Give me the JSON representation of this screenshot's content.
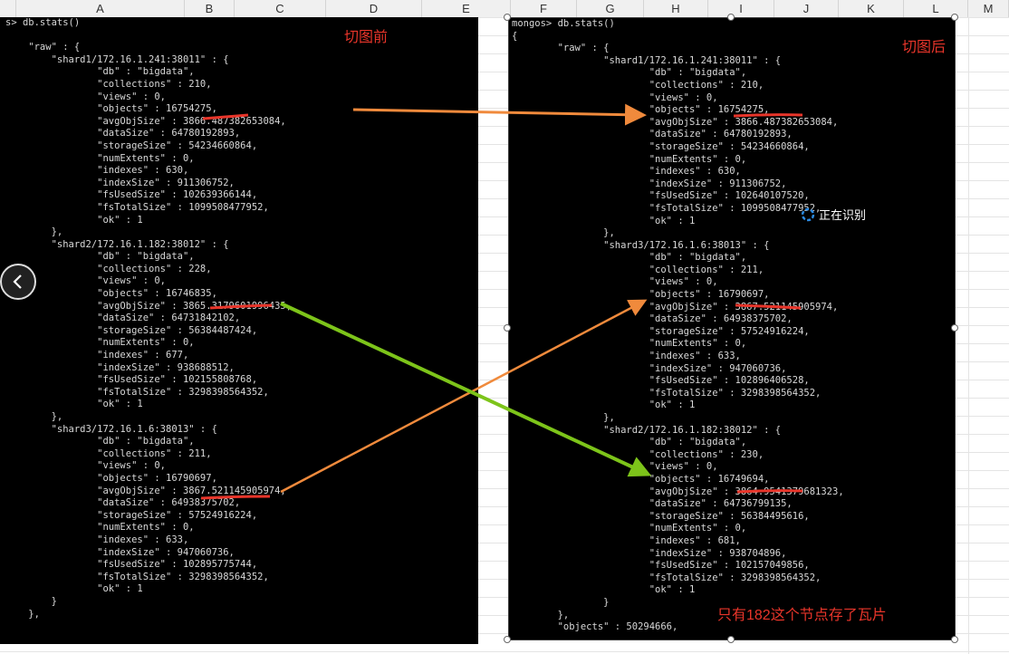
{
  "columns": [
    "A",
    "B",
    "C",
    "D",
    "E",
    "F",
    "G",
    "H",
    "I",
    "J",
    "K",
    "L",
    "M"
  ],
  "left_terminal": {
    "lines": [
      "s> db.stats()",
      "",
      "    \"raw\" : {",
      "        \"shard1/172.16.1.241:38011\" : {",
      "                \"db\" : \"bigdata\",",
      "                \"collections\" : 210,",
      "                \"views\" : 0,",
      "                \"objects\" : 16754275,",
      "                \"avgObjSize\" : 3866.487382653084,",
      "                \"dataSize\" : 64780192893,",
      "                \"storageSize\" : 54234660864,",
      "                \"numExtents\" : 0,",
      "                \"indexes\" : 630,",
      "                \"indexSize\" : 911306752,",
      "                \"fsUsedSize\" : 102639366144,",
      "                \"fsTotalSize\" : 1099508477952,",
      "                \"ok\" : 1",
      "        },",
      "        \"shard2/172.16.1.182:38012\" : {",
      "                \"db\" : \"bigdata\",",
      "                \"collections\" : 228,",
      "                \"views\" : 0,",
      "                \"objects\" : 16746835,",
      "                \"avgObjSize\" : 3865.3179601996435,",
      "                \"dataSize\" : 64731842102,",
      "                \"storageSize\" : 56384487424,",
      "                \"numExtents\" : 0,",
      "                \"indexes\" : 677,",
      "                \"indexSize\" : 938688512,",
      "                \"fsUsedSize\" : 102155808768,",
      "                \"fsTotalSize\" : 3298398564352,",
      "                \"ok\" : 1",
      "        },",
      "        \"shard3/172.16.1.6:38013\" : {",
      "                \"db\" : \"bigdata\",",
      "                \"collections\" : 211,",
      "                \"views\" : 0,",
      "                \"objects\" : 16790697,",
      "                \"avgObjSize\" : 3867.521145905974,",
      "                \"dataSize\" : 64938375702,",
      "                \"storageSize\" : 57524916224,",
      "                \"numExtents\" : 0,",
      "                \"indexes\" : 633,",
      "                \"indexSize\" : 947060736,",
      "                \"fsUsedSize\" : 102895775744,",
      "                \"fsTotalSize\" : 3298398564352,",
      "                \"ok\" : 1",
      "        }",
      "    },"
    ]
  },
  "right_terminal": {
    "lines": [
      "mongos> db.stats()",
      "{",
      "        \"raw\" : {",
      "                \"shard1/172.16.1.241:38011\" : {",
      "                        \"db\" : \"bigdata\",",
      "                        \"collections\" : 210,",
      "                        \"views\" : 0,",
      "                        \"objects\" : 16754275,",
      "                        \"avgObjSize\" : 3866.487382653084,",
      "                        \"dataSize\" : 64780192893,",
      "                        \"storageSize\" : 54234660864,",
      "                        \"numExtents\" : 0,",
      "                        \"indexes\" : 630,",
      "                        \"indexSize\" : 911306752,",
      "                        \"fsUsedSize\" : 102640107520,",
      "                        \"fsTotalSize\" : 1099508477952,",
      "                        \"ok\" : 1",
      "                },",
      "                \"shard3/172.16.1.6:38013\" : {",
      "                        \"db\" : \"bigdata\",",
      "                        \"collections\" : 211,",
      "                        \"views\" : 0,",
      "                        \"objects\" : 16790697,",
      "                        \"avgObjSize\" : 3867.521145905974,",
      "                        \"dataSize\" : 64938375702,",
      "                        \"storageSize\" : 57524916224,",
      "                        \"numExtents\" : 0,",
      "                        \"indexes\" : 633,",
      "                        \"indexSize\" : 947060736,",
      "                        \"fsUsedSize\" : 102896406528,",
      "                        \"fsTotalSize\" : 3298398564352,",
      "                        \"ok\" : 1",
      "                },",
      "                \"shard2/172.16.1.182:38012\" : {",
      "                        \"db\" : \"bigdata\",",
      "                        \"collections\" : 230,",
      "                        \"views\" : 0,",
      "                        \"objects\" : 16749694,",
      "                        \"avgObjSize\" : 3864.9541379681323,",
      "                        \"dataSize\" : 64736799135,",
      "                        \"storageSize\" : 56384495616,",
      "                        \"numExtents\" : 0,",
      "                        \"indexes\" : 681,",
      "                        \"indexSize\" : 938704896,",
      "                        \"fsUsedSize\" : 102157049856,",
      "                        \"fsTotalSize\" : 3298398564352,",
      "                        \"ok\" : 1",
      "                }",
      "        },",
      "        \"objects\" : 50294666,"
    ]
  },
  "annotations": {
    "before_label": "切图前",
    "after_label": "切图后",
    "note_label": "只有182这个节点存了瓦片",
    "ocr_status": "正在识别"
  },
  "colors": {
    "red": "#e8352a",
    "orange_arrow": "#f08a3c",
    "green_arrow": "#7dc41a"
  }
}
